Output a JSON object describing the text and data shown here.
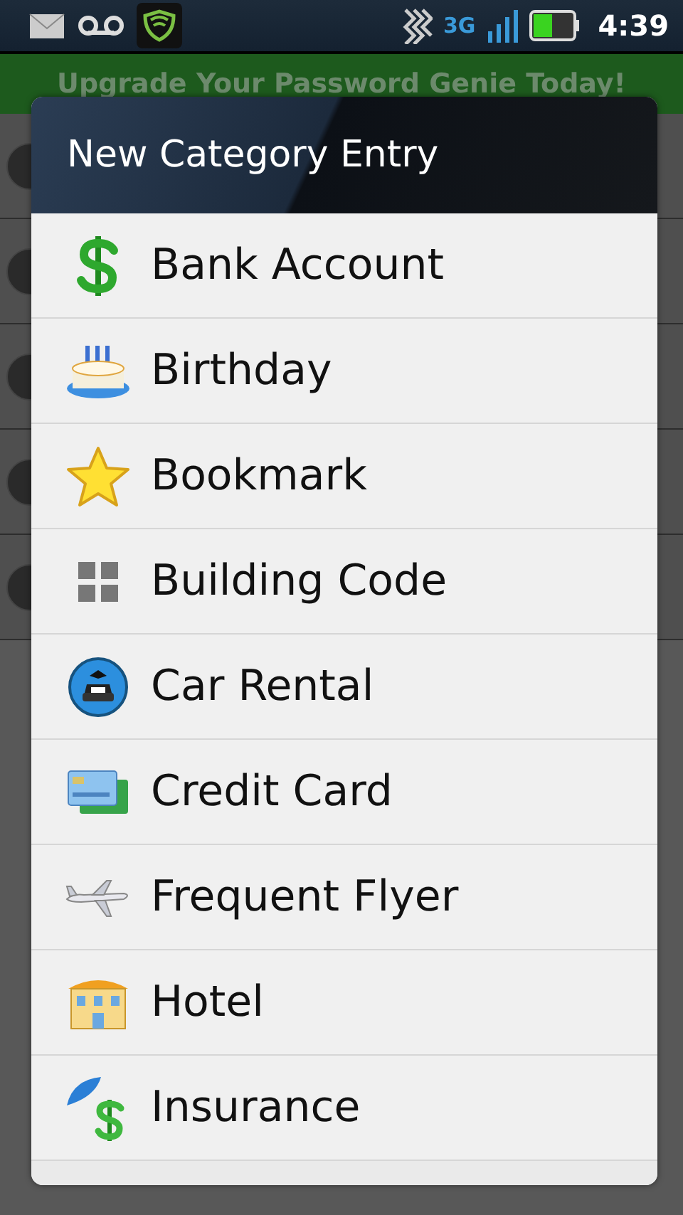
{
  "status_bar": {
    "time": "4:39",
    "network": "3G"
  },
  "banner": {
    "text": "Upgrade Your Password Genie Today!"
  },
  "dialog": {
    "title": "New Category Entry",
    "items": [
      {
        "label": "Bank Account"
      },
      {
        "label": "Birthday"
      },
      {
        "label": "Bookmark"
      },
      {
        "label": "Building Code"
      },
      {
        "label": "Car Rental"
      },
      {
        "label": "Credit Card"
      },
      {
        "label": "Frequent Flyer"
      },
      {
        "label": "Hotel"
      },
      {
        "label": "Insurance"
      }
    ]
  }
}
